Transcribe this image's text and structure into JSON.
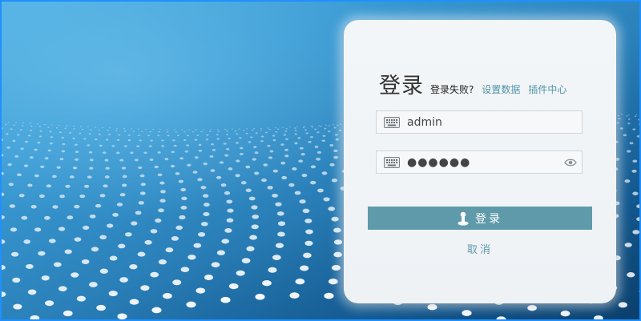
{
  "login": {
    "title": "登录",
    "fail_text": "登录失败?",
    "settings_link": "设置数据",
    "plugins_link": "插件中心",
    "username_value": "admin",
    "password_masked": "●●●●●●",
    "login_button": "登录",
    "cancel_link": "取消"
  },
  "colors": {
    "accent": "#5f9aaa",
    "frame_border": "#1e90ff"
  },
  "icons": [
    "keyboard-icon",
    "eye-icon",
    "user-icon"
  ]
}
